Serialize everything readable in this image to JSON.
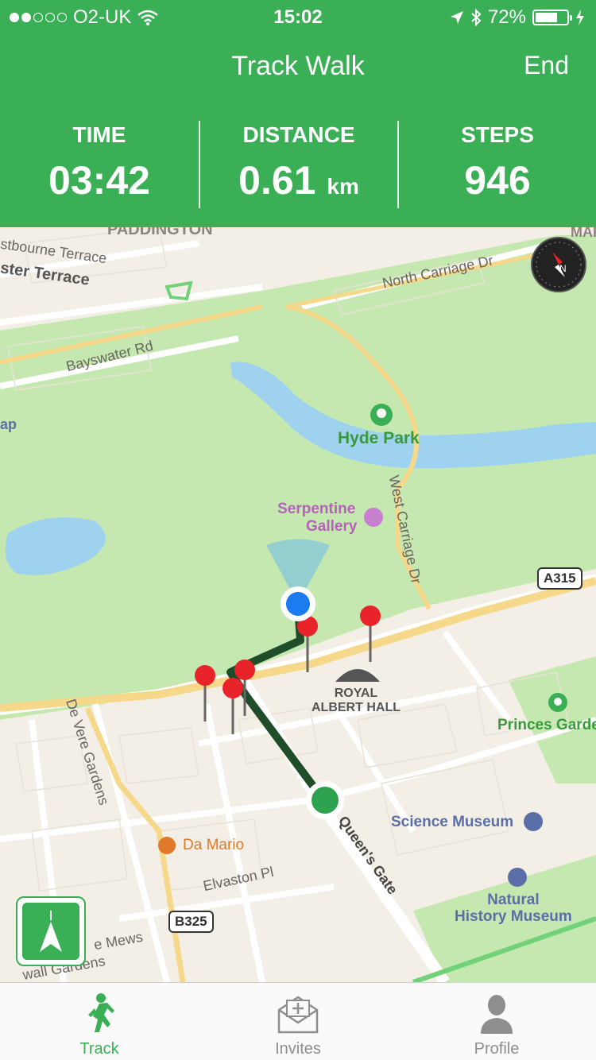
{
  "status_bar": {
    "carrier": "O2-UK",
    "time": "15:02",
    "battery": "72%",
    "battery_level": 0.72
  },
  "header": {
    "title": "Track Walk",
    "end_label": "End"
  },
  "stats": {
    "time_label": "TIME",
    "time_value": "03:42",
    "distance_label": "DISTANCE",
    "distance_value": "0.61",
    "distance_unit": "km",
    "steps_label": "STEPS",
    "steps_value": "946"
  },
  "map": {
    "labels": {
      "paddington": "PADDINGTON",
      "westbourne_terrace": "stbourne Terrace",
      "chester_terrace": "ster Terrace",
      "north_carriage": "North Carriage Dr",
      "bayswater": "Bayswater Rd",
      "hyde_park": "Hyde Park",
      "serpentine_1": "Serpentine",
      "serpentine_2": "Gallery",
      "west_carriage": "West Carriage Dr",
      "a315": "A315",
      "royal_albert_1": "ROYAL",
      "royal_albert_2": "ALBERT HALL",
      "princes_garden": "Princes Garde",
      "de_vere": "De Vere Gardens",
      "science_museum": "Science Museum",
      "da_mario": "Da Mario",
      "queens_gate": "Queen's Gate",
      "elvaston": "Elvaston Pl",
      "natural_history_1": "Natural",
      "natural_history_2": "History Museum",
      "b325": "B325",
      "mews": "e Mews",
      "gardens": "wall Gardens",
      "map_edge_left": "ap",
      "map_edge_right": "MAR"
    }
  },
  "tabs": [
    {
      "label": "Track",
      "icon": "walking-person-icon",
      "active": true
    },
    {
      "label": "Invites",
      "icon": "envelope-plus-icon",
      "active": false
    },
    {
      "label": "Profile",
      "icon": "person-silhouette-icon",
      "active": false
    }
  ],
  "colors": {
    "brand_green": "#3aaf56",
    "park_green": "#c4e8b0",
    "water_blue": "#9fd2ef",
    "route_green": "#1f4d2a",
    "pin_red": "#e8232a",
    "user_blue": "#1a7cf0"
  }
}
